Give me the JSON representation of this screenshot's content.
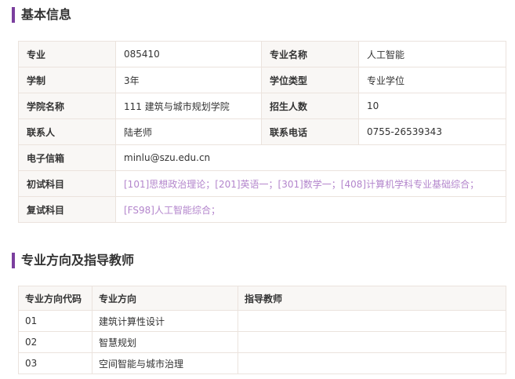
{
  "basic": {
    "title": "基本信息",
    "major_label": "专业",
    "major_value": "085410",
    "major_name_label": "专业名称",
    "major_name_value": "人工智能",
    "duration_label": "学制",
    "duration_value": "3年",
    "degree_type_label": "学位类型",
    "degree_type_value": "专业学位",
    "college_label": "学院名称",
    "college_value": "111 建筑与城市规划学院",
    "enrollment_label": "招生人数",
    "enrollment_value": "10",
    "contact_label": "联系人",
    "contact_value": "陆老师",
    "phone_label": "联系电话",
    "phone_value": "0755-26539343",
    "email_label": "电子信箱",
    "email_value": "minlu@szu.edu.cn",
    "initial_exam_label": "初试科目",
    "initial_exam_value": "[101]思想政治理论；[201]英语一；[301]数学一；[408]计算机学科专业基础综合；",
    "retest_label": "复试科目",
    "retest_value": "[FS98]人工智能综合；"
  },
  "directions": {
    "title": "专业方向及指导教师",
    "headers": {
      "code": "专业方向代码",
      "direction": "专业方向",
      "advisor": "指导教师"
    },
    "rows": [
      {
        "code": "01",
        "direction": "建筑计算性设计",
        "advisor": ""
      },
      {
        "code": "02",
        "direction": "智慧规划",
        "advisor": ""
      },
      {
        "code": "03",
        "direction": "空间智能与城市治理",
        "advisor": ""
      }
    ]
  }
}
